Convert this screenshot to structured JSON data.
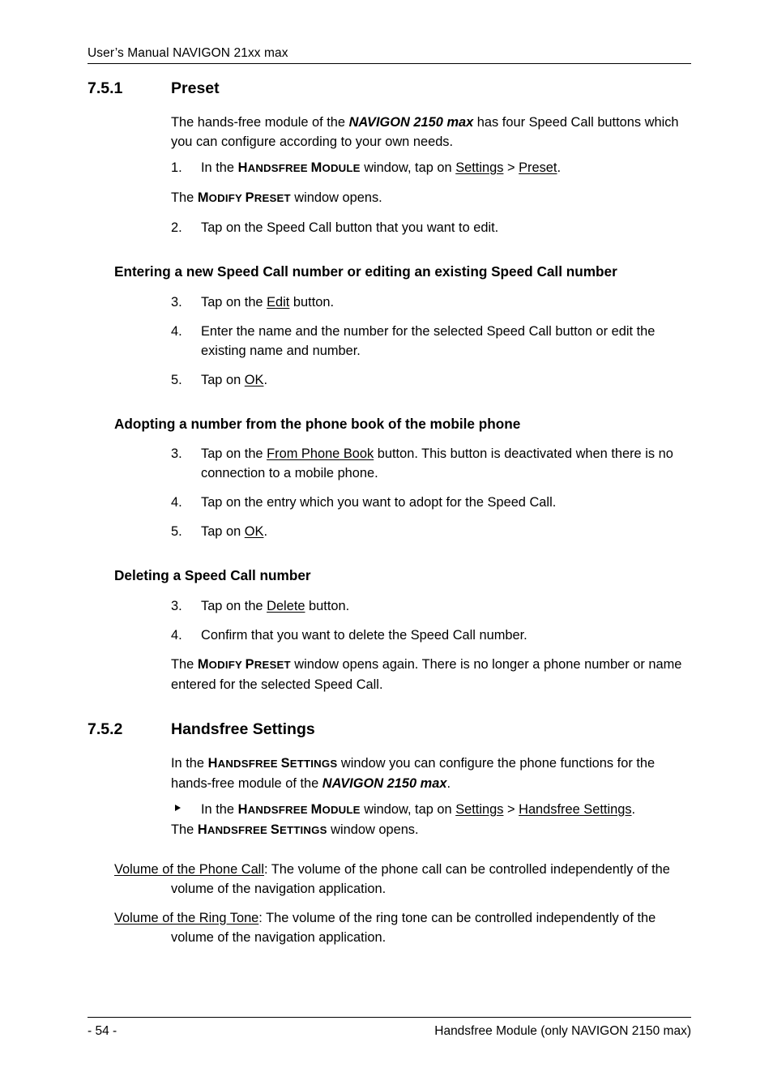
{
  "header": {
    "title": "User’s Manual NAVIGON 21xx max"
  },
  "footer": {
    "page_number": "- 54 -",
    "section_label": "Handsfree Module (only NAVIGON 2150 max)"
  },
  "sections": {
    "preset": {
      "number": "7.5.1",
      "title": "Preset",
      "intro_a": "The hands-free module of the ",
      "intro_product": "NAVIGON 2150 max",
      "intro_b": " has four Speed Call buttons which you can configure according to your own needs.",
      "step1": {
        "marker": "1.",
        "a": "In the ",
        "window_cap": "H",
        "window_rest": "ANDSFREE ",
        "window_cap2": "M",
        "window_rest2": "ODULE",
        "b": " window, tap on ",
        "link1": "Settings",
        "c": " > ",
        "link2": "Preset",
        "d": "."
      },
      "step1_result": {
        "a": "The ",
        "window_cap": "M",
        "window_rest": "ODIFY ",
        "window_cap2": "P",
        "window_rest2": "RESET",
        "b": " window opens."
      },
      "step2": {
        "marker": "2.",
        "text": "Tap on the Speed Call button that you want to edit."
      }
    },
    "entering": {
      "heading": "Entering a new Speed Call number or editing an existing Speed Call number",
      "step3": {
        "marker": "3.",
        "a": "Tap on the ",
        "link": "Edit",
        "b": " button."
      },
      "step4": {
        "marker": "4.",
        "text": "Enter the name and the number for the selected Speed Call button or edit the existing name and number."
      },
      "step5": {
        "marker": "5.",
        "a": "Tap on ",
        "link": "OK",
        "b": "."
      }
    },
    "adopting": {
      "heading": "Adopting a number from the phone book of the mobile phone",
      "step3": {
        "marker": "3.",
        "a": "Tap on the ",
        "link": "From Phone Book",
        "b": " button. This button is deactivated when there is no connection to a mobile phone."
      },
      "step4": {
        "marker": "4.",
        "text": "Tap on the entry which you want to adopt for the Speed Call."
      },
      "step5": {
        "marker": "5.",
        "a": "Tap on ",
        "link": "OK",
        "b": "."
      }
    },
    "deleting": {
      "heading": "Deleting a Speed Call number",
      "step3": {
        "marker": "3.",
        "a": "Tap on the ",
        "link": "Delete",
        "b": " button."
      },
      "step4": {
        "marker": "4.",
        "text": "Confirm that you want to delete the Speed Call number."
      },
      "step4_result": {
        "a": "The ",
        "window_cap": "M",
        "window_rest": "ODIFY ",
        "window_cap2": "P",
        "window_rest2": "RESET",
        "b": " window opens again. There is no longer a phone number or name entered for the selected Speed Call."
      }
    },
    "handsfree_settings": {
      "number": "7.5.2",
      "title": "Handsfree Settings",
      "intro": {
        "a": "In the ",
        "window_cap": "H",
        "window_rest": "ANDSFREE ",
        "window_cap2": "S",
        "window_rest2": "ETTINGS",
        "b": " window you can configure the phone functions for the hands-free module of the ",
        "product": "NAVIGON 2150 max",
        "c": "."
      },
      "bullet": {
        "marker": "▸",
        "a": "In the ",
        "window_cap": "H",
        "window_rest": "ANDSFREE ",
        "window_cap2": "M",
        "window_rest2": "ODULE",
        "b": " window, tap on ",
        "link1": "Settings",
        "c": " > ",
        "link2": "Handsfree Settings",
        "d": "."
      },
      "bullet_result": {
        "a": "The ",
        "window_cap": "H",
        "window_rest": "ANDSFREE ",
        "window_cap2": "S",
        "window_rest2": "ETTINGS",
        "b": " window opens."
      },
      "def_phone_call": {
        "term": "Volume of the Phone Call",
        "body": ": The volume of the phone call can be controlled independently of the volume of the navigation application."
      },
      "def_ring_tone": {
        "term": "Volume of the Ring Tone",
        "body": ": The volume of the ring tone can be controlled independently of the volume of the navigation application."
      }
    }
  }
}
